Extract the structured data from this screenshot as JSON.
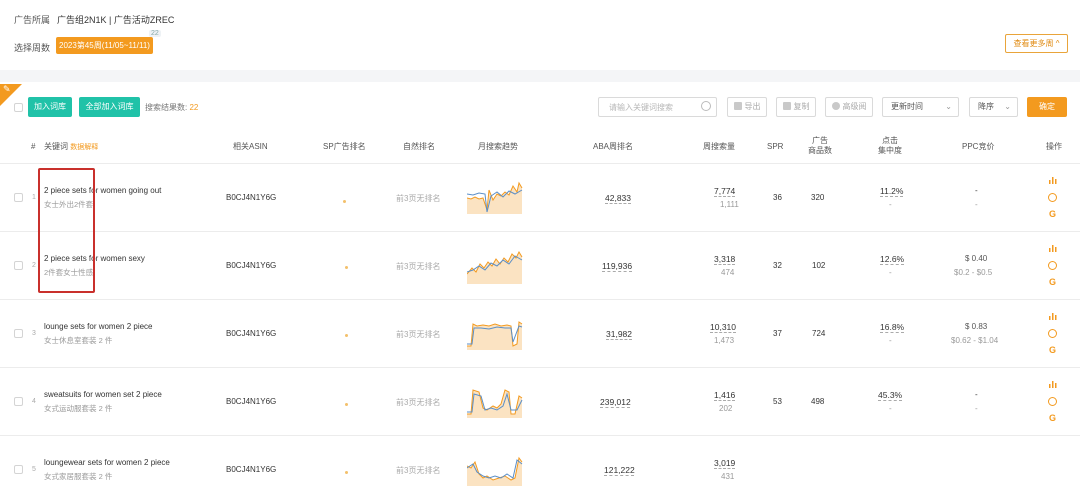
{
  "header": {
    "ad_owner_label": "广告所属",
    "ad_owner_value": "广告组2N1K | 广告活动ZREC",
    "week_label": "选择周数",
    "week_value": "2023第45周(11/05~11/11)",
    "week_badge": "22",
    "more_button": "查看更多周 ^"
  },
  "toolbar": {
    "add_button": "加入词库",
    "add_all_button": "全部加入词库",
    "result_label": "搜索结果数:",
    "result_count": "22",
    "search_placeholder": "请输入关键词搜索",
    "export": "导出",
    "copy": "复制",
    "view": "高级阅",
    "sort_field": "更新时间",
    "sort_order": "降序",
    "confirm": "确定"
  },
  "columns": {
    "index": "#",
    "keyword": "关键词",
    "data_explain": "数据解释",
    "asin": "相关ASIN",
    "sp_rank": "SP广告排名",
    "natural_rank": "自然排名",
    "trend": "月搜索趋势",
    "aba_rank": "ABA周排名",
    "weekly_search": "周搜索量",
    "spr": "SPR",
    "ad_products_1": "广告",
    "ad_products_2": "商品数",
    "click_conc_1": "点击",
    "click_conc_2": "集中度",
    "ppc": "PPC竞价",
    "actions": "操作"
  },
  "rows": [
    {
      "index": "1",
      "keyword": "2 piece sets for women going out",
      "translation": "女士外出2件套",
      "asin": "B0CJ4N1Y6G",
      "natural_rank": "前3页无排名",
      "aba_rank": "42,833",
      "weekly_search": "7,774",
      "weekly_search_sub": "1,111",
      "spr": "36",
      "ad_products": "320",
      "click_conc": "11.2%",
      "click_conc_sub": "-",
      "ppc": "-",
      "ppc_range": "-"
    },
    {
      "index": "2",
      "keyword": "2 piece sets for women sexy",
      "translation": "2件套女士性感",
      "asin": "B0CJ4N1Y6G",
      "natural_rank": "前3页无排名",
      "aba_rank": "119,936",
      "weekly_search": "3,318",
      "weekly_search_sub": "474",
      "spr": "32",
      "ad_products": "102",
      "click_conc": "12.6%",
      "click_conc_sub": "-",
      "ppc": "$ 0.40",
      "ppc_range": "$0.2 - $0.5"
    },
    {
      "index": "3",
      "keyword": "lounge sets for women 2 piece",
      "translation": "女士休息室套装 2 件",
      "asin": "B0CJ4N1Y6G",
      "natural_rank": "前3页无排名",
      "aba_rank": "31,982",
      "weekly_search": "10,310",
      "weekly_search_sub": "1,473",
      "spr": "37",
      "ad_products": "724",
      "click_conc": "16.8%",
      "click_conc_sub": "-",
      "ppc": "$ 0.83",
      "ppc_range": "$0.62 - $1.04"
    },
    {
      "index": "4",
      "keyword": "sweatsuits for women set 2 piece",
      "translation": "女式运动服套装 2 件",
      "asin": "B0CJ4N1Y6G",
      "natural_rank": "前3页无排名",
      "aba_rank": "239,012",
      "weekly_search": "1,416",
      "weekly_search_sub": "202",
      "spr": "53",
      "ad_products": "498",
      "click_conc": "45.3%",
      "click_conc_sub": "-",
      "ppc": "-",
      "ppc_range": "-"
    },
    {
      "index": "5",
      "keyword": "loungewear sets for women 2 piece",
      "translation": "女式家居服套装 2 件",
      "asin": "B0CJ4N1Y6G",
      "natural_rank": "前3页无排名",
      "aba_rank": "121,222",
      "weekly_search": "3,019",
      "weekly_search_sub": "431",
      "spr": "",
      "ad_products": "",
      "click_conc": "",
      "click_conc_sub": "",
      "ppc": "",
      "ppc_range": ""
    }
  ],
  "colors": {
    "accent": "#f39a1f",
    "teal": "#20c2a8",
    "highlight": "#c9302c"
  }
}
